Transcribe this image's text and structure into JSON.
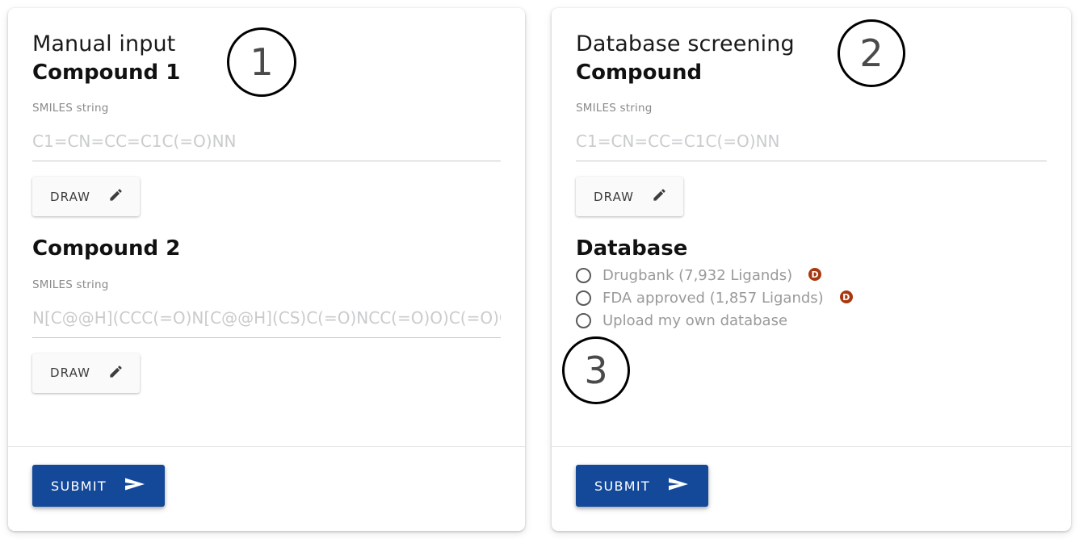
{
  "panels": [
    {
      "id": "manual-input",
      "panel_title": "Manual input",
      "callout": "1",
      "sections": [
        {
          "heading": "Compound 1",
          "field_label": "SMILES string",
          "input_value": "",
          "input_placeholder": "C1=CN=CC=C1C(=O)NN",
          "draw_button": "DRAW"
        },
        {
          "heading": "Compound 2",
          "field_label": "SMILES string",
          "input_value": "",
          "input_placeholder": "N[C@@H](CCC(=O)N[C@@H](CS)C(=O)NCC(=O)O)C(=O)O",
          "draw_button": "DRAW"
        }
      ],
      "submit_label": "SUBMIT"
    },
    {
      "id": "database-screening",
      "panel_title": "Database screening",
      "callout": "2",
      "sections": [
        {
          "heading": "Compound",
          "field_label": "SMILES string",
          "input_value": "",
          "input_placeholder": "C1=CN=CC=C1C(=O)NN",
          "draw_button": "DRAW"
        }
      ],
      "database": {
        "heading": "Database",
        "callout": "3",
        "options": [
          {
            "label": "Drugbank (7,932 Ligands)",
            "badge": "D",
            "selected": false
          },
          {
            "label": "FDA approved (1,857 Ligands)",
            "badge": "D",
            "selected": false
          },
          {
            "label": "Upload my own database",
            "badge": "",
            "selected": false
          }
        ]
      },
      "submit_label": "SUBMIT"
    }
  ],
  "icons": {
    "pencil": "pencil-icon",
    "send": "send-icon",
    "radio": "radio-circle-icon",
    "database_badge": "database-badge-icon"
  },
  "colors": {
    "submit_blue": "#14499a",
    "badge_red": "#a8380f",
    "placeholder_gray": "#c9cbcd",
    "label_gray": "#8a8a8a",
    "option_gray": "#9a9a9a",
    "card_background": "#ffffff"
  }
}
